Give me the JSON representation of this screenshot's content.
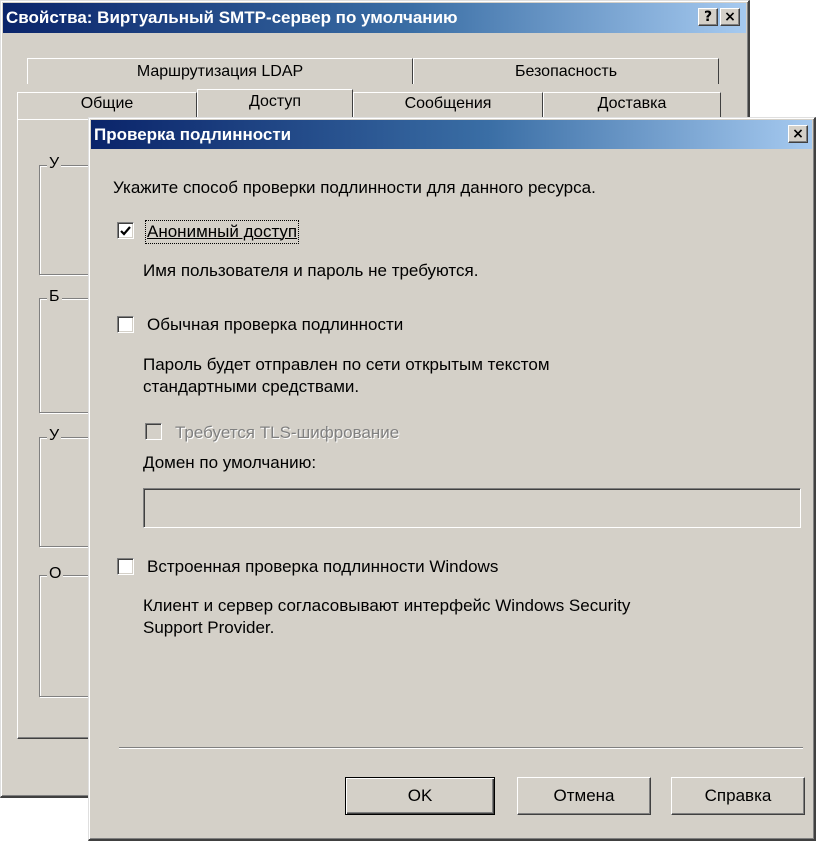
{
  "back_window": {
    "title": "Свойства: Виртуальный SMTP-сервер по умолчанию",
    "help_button": "?",
    "close_button": "×",
    "tabs_row1": [
      "Маршрутизация LDAP",
      "Безопасность"
    ],
    "tabs_row2": [
      "Общие",
      "Доступ",
      "Сообщения",
      "Доставка"
    ],
    "group_initials": [
      "У",
      "Б",
      "У",
      "О"
    ]
  },
  "dialog": {
    "title": "Проверка подлинности",
    "close_button": "×",
    "intro": "Укажите способ проверки подлинности для данного ресурса.",
    "anonymous": {
      "label": "Анонимный доступ",
      "checked": true,
      "description": "Имя пользователя и пароль не требуются."
    },
    "basic": {
      "label": "Обычная проверка подлинности",
      "checked": false,
      "description_line1": "Пароль будет отправлен по сети открытым текстом",
      "description_line2": "стандартными средствами.",
      "tls_label": "Требуется TLS-шифрование",
      "tls_checked": false,
      "tls_enabled": false,
      "domain_label": "Домен по умолчанию:",
      "domain_value": ""
    },
    "windows": {
      "label": "Встроенная проверка подлинности Windows",
      "checked": false,
      "description_line1": "Клиент и сервер согласовывают интерфейс Windows Security",
      "description_line2": "Support Provider."
    },
    "buttons": {
      "ok": "OK",
      "cancel": "Отмена",
      "help": "Справка"
    }
  },
  "colors": {
    "titlebar_start": "#0a246a",
    "titlebar_end": "#a6caf0",
    "face": "#d4d0c8",
    "disabled_text": "#808080"
  }
}
